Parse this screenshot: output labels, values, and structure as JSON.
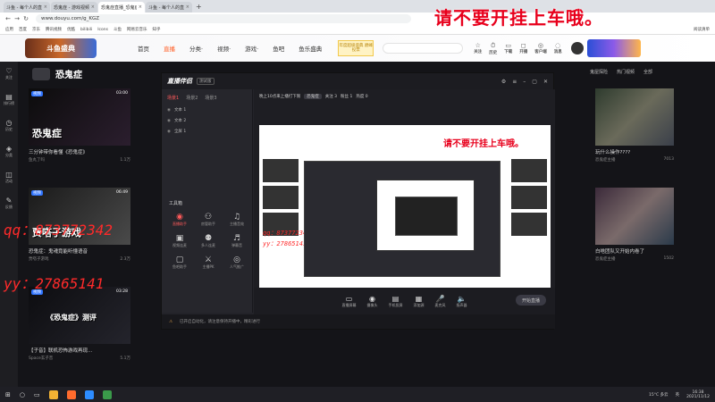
{
  "browser": {
    "tabs": [
      {
        "label": "斗鱼 - 每个人的直播平台",
        "active": false
      },
      {
        "label": "恐鬼症 - 游戏视频 斗鱼",
        "active": false
      },
      {
        "label": "恐鬼症直播_恐鬼症直播",
        "active": true
      },
      {
        "label": "斗鱼 - 每个人的直播平台",
        "active": false
      }
    ],
    "new_tab": "+",
    "url": "www.douyu.com/g_KGZ",
    "bookmarks": [
      "应用",
      "百度",
      "京东",
      "腾讯视频",
      "优酷",
      "bilibili",
      "Icons",
      "斗鱼",
      "网易云音乐",
      "知乎"
    ],
    "bookmarks_right": "阅读清单"
  },
  "overlay": {
    "title": "请不要开挂上车哦。",
    "qq_line": "qq：873772342",
    "yy_line": "yy：27865141"
  },
  "site": {
    "logo": "斗鱼盛典",
    "nav": [
      {
        "label": "首页",
        "active": false
      },
      {
        "label": "直播",
        "active": true
      },
      {
        "label": "分类·",
        "active": false
      },
      {
        "label": "视频·",
        "active": false
      },
      {
        "label": "游戏·",
        "active": false
      },
      {
        "label": "鱼吧",
        "active": false
      },
      {
        "label": "鱼乐盛典",
        "active": false
      }
    ],
    "promo": "年度超级盛典 巅峰投票",
    "header_icons": [
      {
        "icon": "☆",
        "label": "关注"
      },
      {
        "icon": "⏱",
        "label": "历史"
      },
      {
        "icon": "▭",
        "label": "下载"
      },
      {
        "icon": "◻",
        "label": "开播"
      },
      {
        "icon": "◎",
        "label": "客户端"
      },
      {
        "icon": "◌",
        "label": "消息"
      }
    ]
  },
  "sidebar": {
    "items": [
      {
        "icon": "♡",
        "label": "关注"
      },
      {
        "icon": "▤",
        "label": "排行榜"
      },
      {
        "icon": "◷",
        "label": "历史"
      },
      {
        "icon": "◈",
        "label": "分类"
      },
      {
        "icon": "◫",
        "label": "活动"
      },
      {
        "icon": "✎",
        "label": "反馈"
      }
    ]
  },
  "category": {
    "name": "恐鬼症",
    "right_options": [
      "鬼屋探险",
      "热门视频",
      "全部"
    ]
  },
  "cards": [
    {
      "tag": "视频",
      "duration": "03:00",
      "thumb_text": "恐鬼症",
      "title": "三分钟带你看懂《恐鬼症》",
      "author": "鱼丸了吗",
      "views": "1.1万"
    },
    {
      "tag": "视频",
      "duration": "06:49",
      "thumb_text": "贾嗒子游戏",
      "title": "恐鬼症：鬼魂竟能听懂语音",
      "author": "贾嗒子游戏",
      "views": "2.3万"
    },
    {
      "tag": "视频",
      "duration": "03:28",
      "thumb_text": "《恐鬼症》测评",
      "title": "【子音】联机恐怖游戏再现...",
      "author": "Space玄子音",
      "views": "5.1万"
    }
  ],
  "right_cards": [
    {
      "title": "玩什么操作????",
      "author": "恐鬼症主播",
      "views": "7013"
    },
    {
      "title": "白啥团队又开始内卷了",
      "author": "恐鬼症主播",
      "views": "1502"
    }
  ],
  "app": {
    "title": "直播伴侣",
    "version": "测试版",
    "tabs": [
      {
        "label": "场景1",
        "active": true
      },
      {
        "label": "场景2",
        "active": false
      },
      {
        "label": "场景3",
        "active": false
      }
    ],
    "scenes": [
      "文本 1",
      "文本 2",
      "全屏 1"
    ],
    "tools_label": "工具箱",
    "tools": [
      {
        "icon": "◉",
        "label": "直播助手",
        "hot": true
      },
      {
        "icon": "⚇",
        "label": "房管助手",
        "hot": false
      },
      {
        "icon": "♫",
        "label": "主播音效",
        "hot": false
      },
      {
        "icon": "▣",
        "label": "视频连麦",
        "hot": false
      },
      {
        "icon": "⚉",
        "label": "多人连麦",
        "hot": false
      },
      {
        "icon": "♬",
        "label": "弹幕音",
        "hot": false
      },
      {
        "icon": "▢",
        "label": "鱼吧助手",
        "hot": false
      },
      {
        "icon": "⚔",
        "label": "主播PK",
        "hot": false
      },
      {
        "icon": "◎",
        "label": "人气推广",
        "hot": false
      }
    ],
    "room_title": "晚上10点来上播打下限",
    "room_tag": "恐鬼症",
    "room_stats": [
      "关注 3",
      "粉丝 1",
      "热度 0"
    ],
    "bottom_buttons": [
      {
        "icon": "▭",
        "label": "直播屏幕"
      },
      {
        "icon": "◉",
        "label": "摄像头"
      },
      {
        "icon": "▤",
        "label": "手机投屏"
      },
      {
        "icon": "▦",
        "label": "添加源"
      },
      {
        "icon": "🎤",
        "label": "麦克风"
      },
      {
        "icon": "🔈",
        "label": "扬声器"
      }
    ],
    "start_label": "开始直播",
    "status": "已开启自动化，请注意保持开播中，精彩进行"
  },
  "taskbar": {
    "weather": "15°C 多云",
    "time": "16:38",
    "date": "2021/11/12",
    "lang": "英"
  }
}
